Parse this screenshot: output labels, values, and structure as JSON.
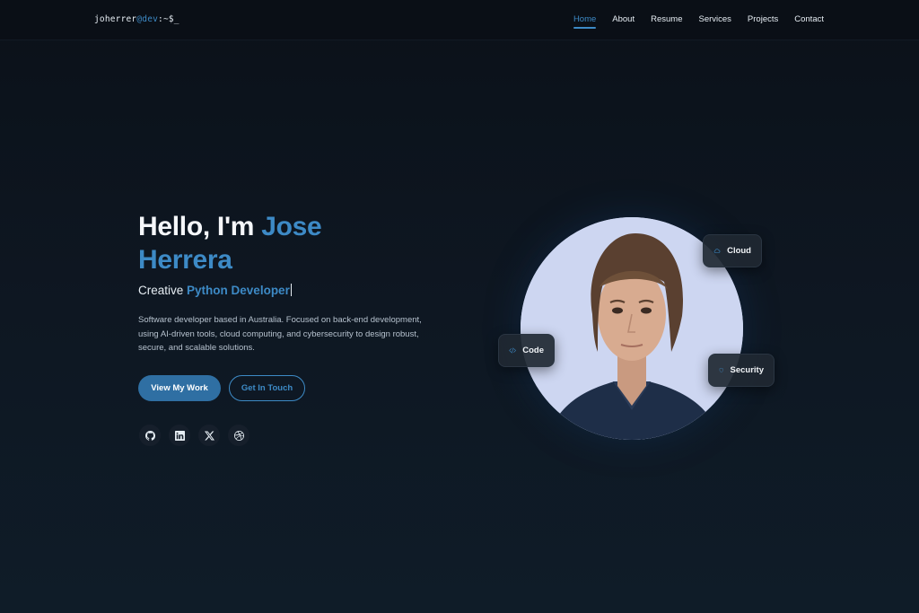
{
  "header": {
    "logo_user": "joherrer",
    "logo_host": "@dev",
    "logo_path": ":~$_",
    "nav": [
      {
        "label": "Home",
        "active": true
      },
      {
        "label": "About"
      },
      {
        "label": "Resume"
      },
      {
        "label": "Services"
      },
      {
        "label": "Projects"
      },
      {
        "label": "Contact"
      }
    ]
  },
  "hero": {
    "greeting": "Hello, I'm",
    "name": "Jose Herrera",
    "subtitle_prefix": "Creative",
    "subtitle_role": "Python Developer",
    "description": "Software developer based in Australia. Focused on back-end development, using AI-driven tools, cloud computing, and cybersecurity to design robust, secure, and scalable solutions.",
    "primary_button": "View My Work",
    "secondary_button": "Get In Touch",
    "socials": [
      "github-icon",
      "linkedin-icon",
      "x-icon",
      "dribbble-icon"
    ]
  },
  "chips": {
    "cloud": "Cloud",
    "code": "Code",
    "security": "Security"
  },
  "colors": {
    "accent": "#3d8ac6",
    "background": "#0e1722",
    "primary_button": "#2f6fa3"
  }
}
